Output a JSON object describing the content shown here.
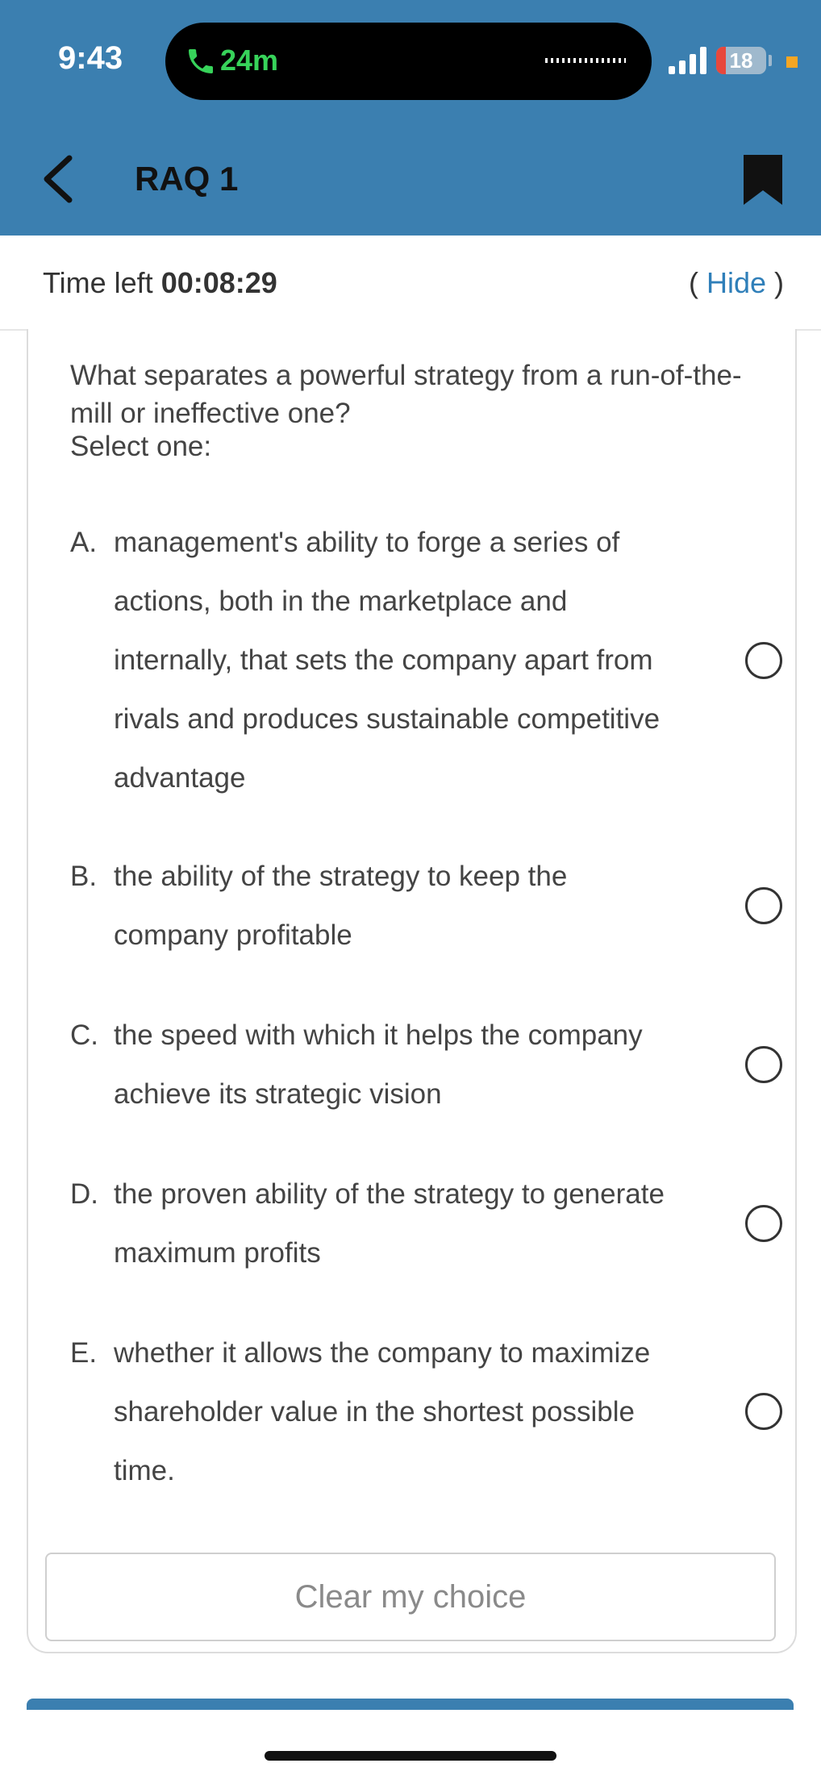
{
  "status_bar": {
    "time": "9:43",
    "call_duration": "24m",
    "battery_level": "18",
    "accent_colors": {
      "call": "#37d35a",
      "battery_low": "#e8483c",
      "indicator": "#f5a623"
    }
  },
  "header": {
    "title": "RAQ 1",
    "back_icon": "chevron-left-icon",
    "bookmark_icon": "bookmark-icon",
    "background": "#3b7fb0"
  },
  "timer": {
    "label": "Time left ",
    "value": "00:08:29",
    "hide_open": "( ",
    "hide_label": "Hide",
    "hide_close": " )"
  },
  "question": {
    "text": "What separates a powerful strategy from a run-of-the-mill or ineffective one?",
    "instruction": "Select one:",
    "options": [
      {
        "letter": "A.",
        "text": "management's ability to forge a series of actions, both in the marketplace and internally, that sets the company apart from rivals and produces sustainable competitive advantage",
        "selected": false
      },
      {
        "letter": "B.",
        "text": "the ability of the strategy to keep the company profitable",
        "selected": false
      },
      {
        "letter": "C.",
        "text": "the speed with which it helps the company achieve its strategic vision",
        "selected": false
      },
      {
        "letter": "D.",
        "text": "the proven ability of the strategy to generate maximum profits",
        "selected": false
      },
      {
        "letter": "E.",
        "text": "whether it allows the company to maximize shareholder value in the shortest possible time.",
        "selected": false
      }
    ]
  },
  "clear_button_label": "Clear my choice"
}
